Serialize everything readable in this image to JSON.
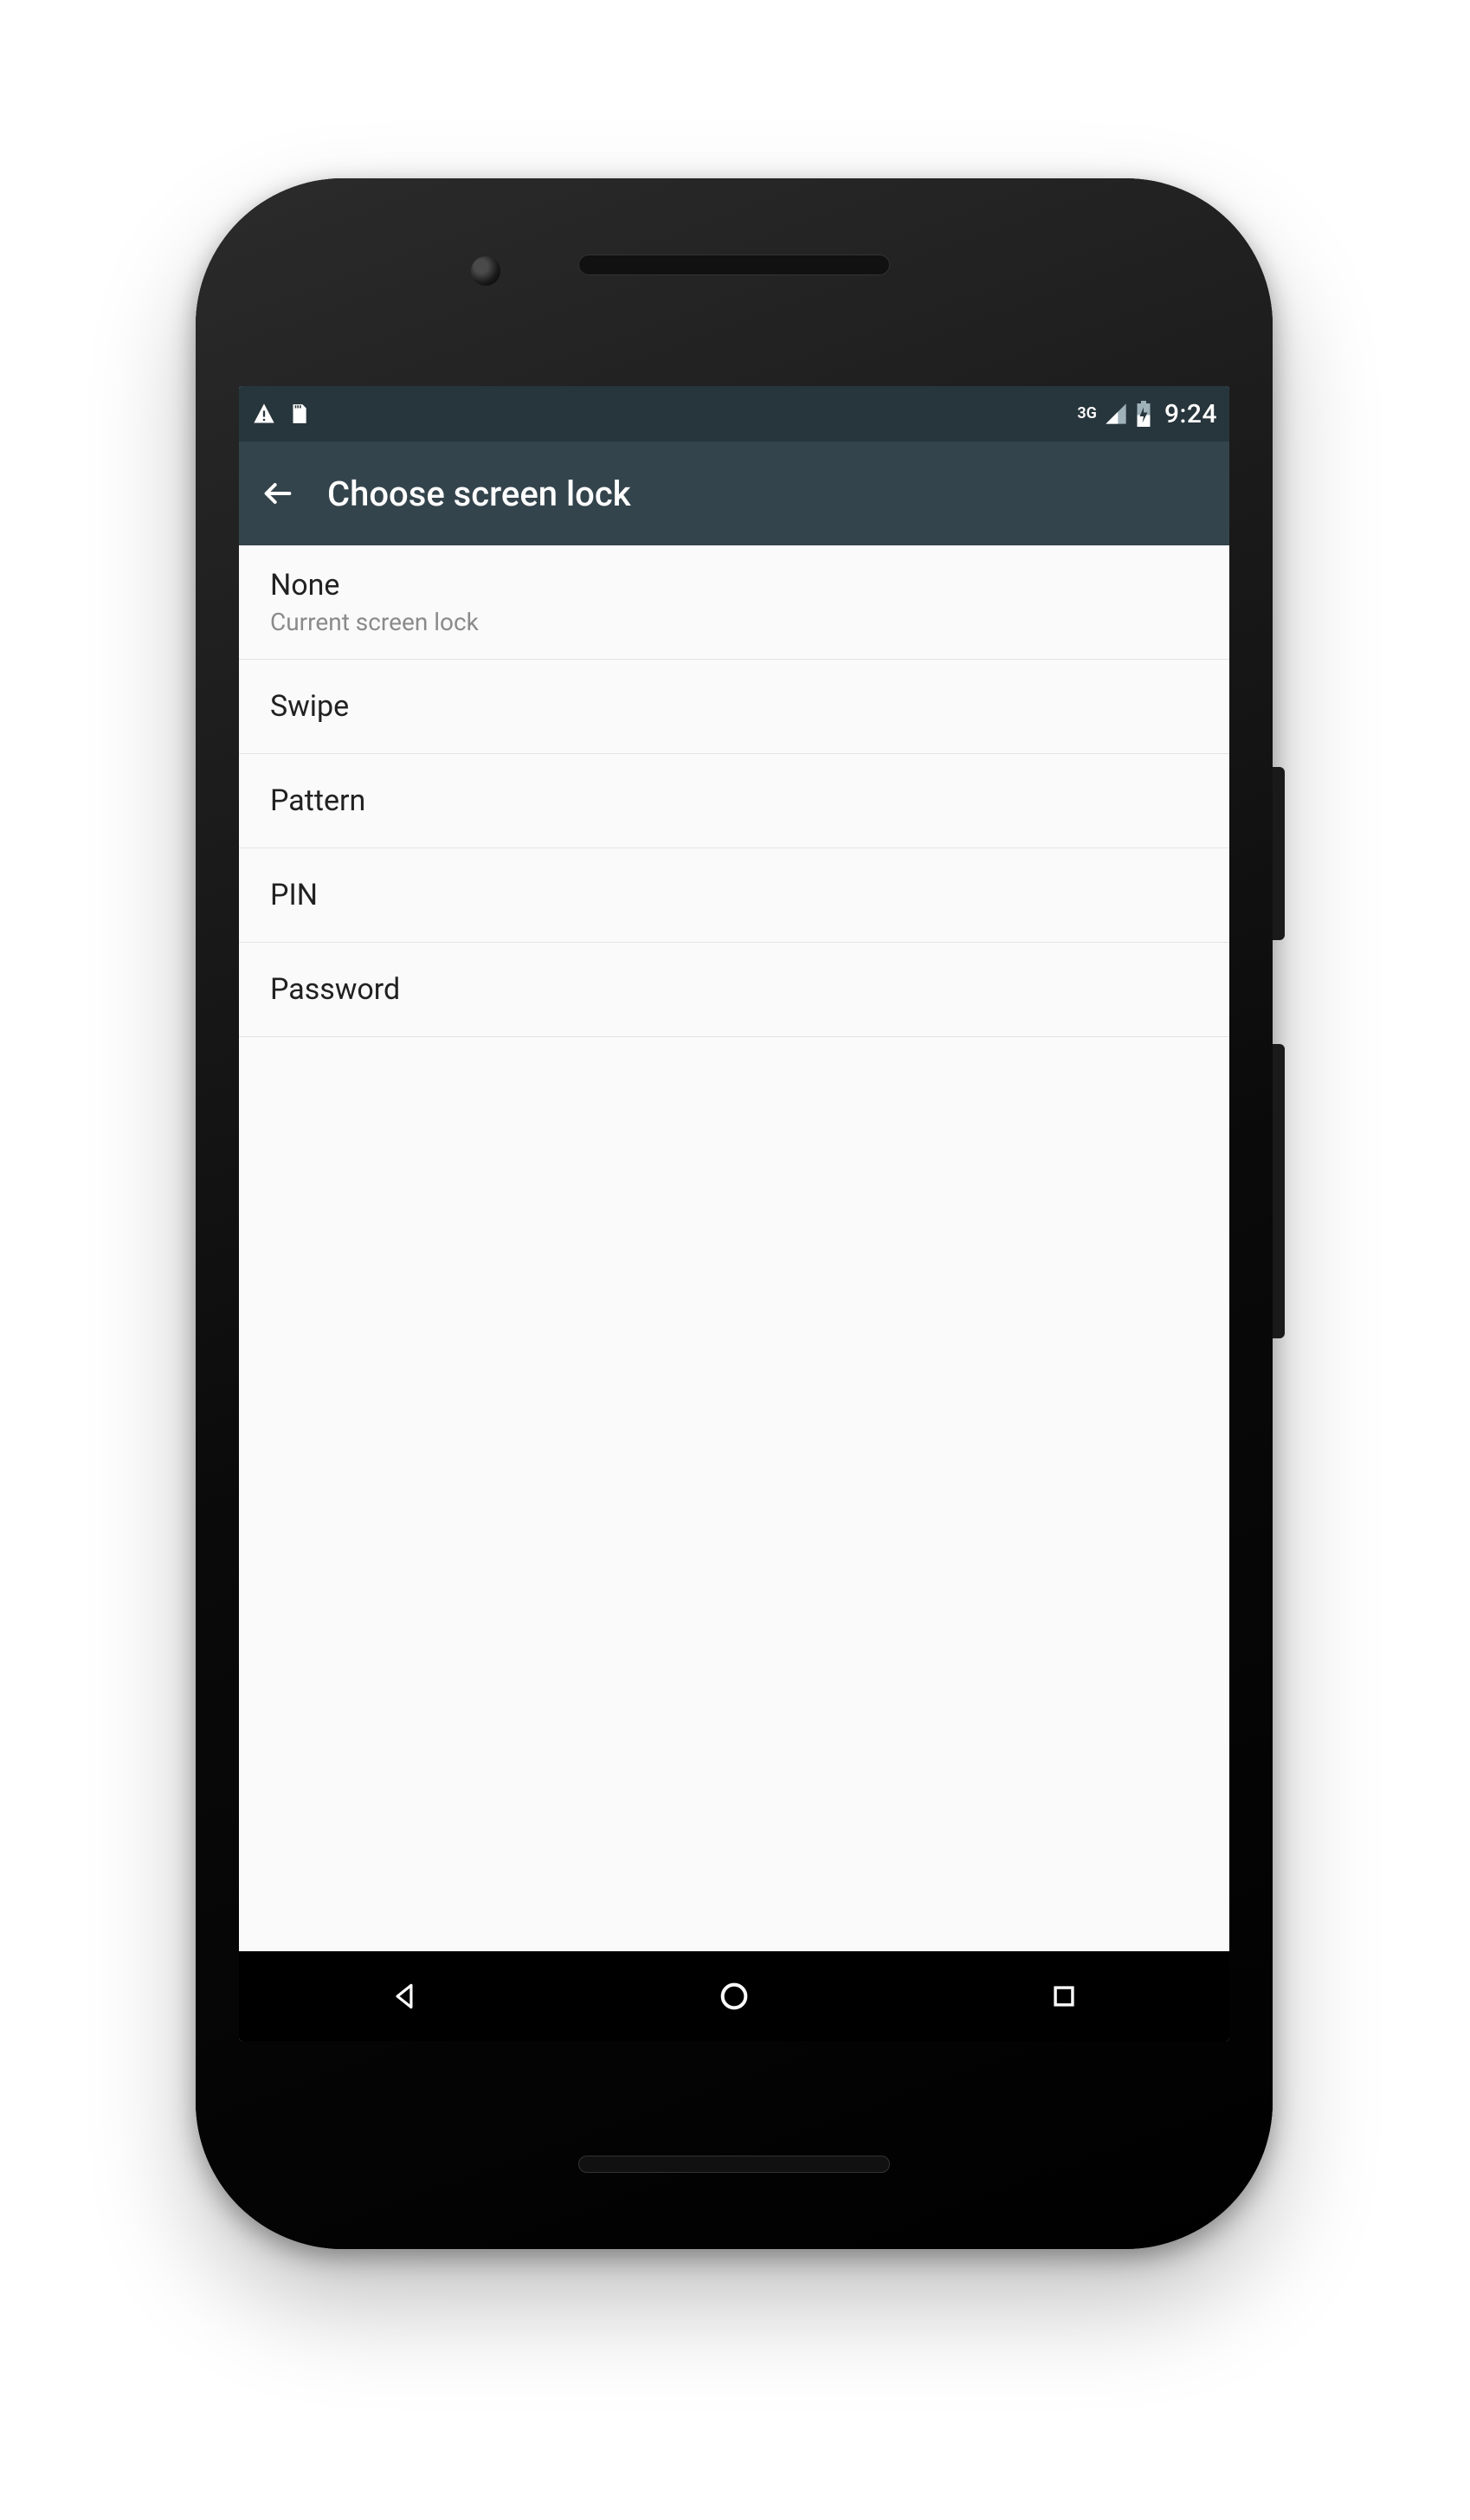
{
  "statusbar": {
    "network_label": "3G",
    "time": "9:24"
  },
  "appbar": {
    "title": "Choose screen lock"
  },
  "options": [
    {
      "label": "None",
      "sublabel": "Current screen lock"
    },
    {
      "label": "Swipe",
      "sublabel": null
    },
    {
      "label": "Pattern",
      "sublabel": null
    },
    {
      "label": "PIN",
      "sublabel": null
    },
    {
      "label": "Password",
      "sublabel": null
    }
  ]
}
